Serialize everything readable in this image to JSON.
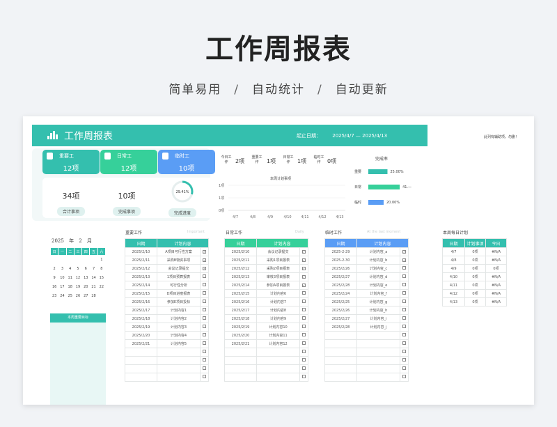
{
  "hero": {
    "title": "工作周报表",
    "features": [
      "简单易用",
      "自动统计",
      "自动更新"
    ],
    "separator": "/"
  },
  "banner": {
    "title": "工作周报表",
    "date_label": "起止日期：",
    "date_start": "2025/4/7",
    "date_end": "2025/4/13",
    "side_note": "此列有辅助项，勿删！"
  },
  "colors": {
    "teal": "#34bfae",
    "green": "#36d09a",
    "blue": "#5a9df5",
    "light": "#dff1ef"
  },
  "cards": [
    {
      "label": "重要工",
      "value": "12项",
      "color": "#34bfae"
    },
    {
      "label": "日常工",
      "value": "12项",
      "color": "#36d09a"
    },
    {
      "label": "临时工",
      "value": "10项",
      "color": "#5a9df5"
    }
  ],
  "stats": [
    {
      "value": "34项",
      "label": "合计事项"
    },
    {
      "value": "10项",
      "label": "完成事项"
    },
    {
      "value": "29.41%",
      "label": "完成进度"
    }
  ],
  "progress_fraction": 0.2941,
  "today": [
    {
      "label": "今日工作",
      "value": "2项"
    },
    {
      "label": "重要工作",
      "value": "1项"
    },
    {
      "label": "日常工作",
      "value": "1项"
    },
    {
      "label": "临时工作",
      "value": "0项"
    }
  ],
  "line_chart": {
    "title": "本周计划事项",
    "y_ticks": [
      "1项",
      "1项",
      "0项"
    ],
    "x": [
      "4/7",
      "4/8",
      "4/9",
      "4/10",
      "4/11",
      "4/12",
      "4/13"
    ]
  },
  "completion": {
    "title": "完成率",
    "rows": [
      {
        "label": "重要",
        "value": "25.00%",
        "fraction": 0.25,
        "color": "#34bfae"
      },
      {
        "label": "日常",
        "value": "41.—",
        "fraction": 0.41,
        "color": "#36d09a"
      },
      {
        "label": "临时",
        "value": "20.00%",
        "fraction": 0.2,
        "color": "#5a9df5"
      }
    ]
  },
  "calendar": {
    "year": "2025",
    "year_suffix": "年",
    "month": "2",
    "month_suffix": "月",
    "weekdays": [
      "日",
      "一",
      "二",
      "三",
      "四",
      "五",
      "六"
    ],
    "weeks": [
      [
        "",
        "",
        "",
        "",
        "",
        "",
        "1"
      ],
      [
        "2",
        "3",
        "4",
        "5",
        "6",
        "7",
        "8"
      ],
      [
        "9",
        "10",
        "11",
        "12",
        "13",
        "14",
        "15"
      ],
      [
        "16",
        "17",
        "18",
        "19",
        "20",
        "21",
        "22"
      ],
      [
        "23",
        "24",
        "25",
        "26",
        "27",
        "28",
        ""
      ]
    ],
    "goal_title": "本周重要目标"
  },
  "important": {
    "title": "重要工作",
    "ghost": "Important",
    "headers": [
      "日期",
      "计划内容"
    ],
    "rows": [
      [
        "2025/2/10",
        "A项目可行性方案",
        "✓"
      ],
      [
        "2025/2/11",
        "采购B物资事项",
        "✓"
      ],
      [
        "2025/2/12",
        "会议记录提交",
        "✓"
      ],
      [
        "2025/2/13",
        "1项目预算报表",
        ""
      ],
      [
        "2025/2/14",
        "可行性分析",
        ""
      ],
      [
        "2025/2/15",
        "D项目进度报表",
        ""
      ],
      [
        "2025/2/16",
        "参加E项目投标",
        ""
      ],
      [
        "2025/2/17",
        "计划内容1",
        ""
      ],
      [
        "2025/2/18",
        "计划内容2",
        ""
      ],
      [
        "2025/2/19",
        "计划内容3",
        ""
      ],
      [
        "2025/2/20",
        "计划内容4",
        ""
      ],
      [
        "2025/2/21",
        "计划内容5",
        ""
      ],
      [
        "",
        "",
        ""
      ],
      [
        "",
        "",
        ""
      ],
      [
        "",
        "",
        ""
      ],
      [
        "",
        "",
        ""
      ]
    ]
  },
  "daily": {
    "title": "日常工作",
    "ghost": "Daily",
    "headers": [
      "日期",
      "计划内容"
    ],
    "rows": [
      [
        "2025/2/10",
        "会议记录提交",
        "✓"
      ],
      [
        "2025/2/11",
        "采购1项目报表",
        "✓"
      ],
      [
        "2025/2/12",
        "采购2项目报表",
        "✓"
      ],
      [
        "2025/2/13",
        "审核3项目报表",
        "✓"
      ],
      [
        "2025/2/14",
        "参加A项目报表",
        "✓"
      ],
      [
        "2025/2/15",
        "计划内容6",
        ""
      ],
      [
        "2025/2/16",
        "计划内容7",
        ""
      ],
      [
        "2025/2/17",
        "计划内容8",
        ""
      ],
      [
        "2025/2/18",
        "计划内容9",
        ""
      ],
      [
        "2025/2/19",
        "计划内容10",
        ""
      ],
      [
        "2025/2/20",
        "计划内容11",
        ""
      ],
      [
        "2025/2/21",
        "计划内容12",
        ""
      ],
      [
        "",
        "",
        ""
      ],
      [
        "",
        "",
        ""
      ],
      [
        "",
        "",
        ""
      ],
      [
        "",
        "",
        ""
      ]
    ]
  },
  "temp": {
    "title": "临时工作",
    "ghost": "At the last moment",
    "headers": [
      "日期",
      "计划内容"
    ],
    "rows": [
      [
        "2025-2-29",
        "计划内容_a",
        "✓"
      ],
      [
        "2025-2-30",
        "计划内容_b",
        "✓"
      ],
      [
        "2025/2/26",
        "计划内容_c",
        ""
      ],
      [
        "2025/2/27",
        "计划内容_d",
        ""
      ],
      [
        "2025/2/28",
        "计划内容_e",
        ""
      ],
      [
        "2025/2/24",
        "计划内容_f",
        ""
      ],
      [
        "2025/2/25",
        "计划内容_g",
        ""
      ],
      [
        "2025/2/26",
        "计划内容_h",
        ""
      ],
      [
        "2025/2/27",
        "计划内容_i",
        ""
      ],
      [
        "2025/2/28",
        "计划内容_j",
        ""
      ],
      [
        "",
        "",
        ""
      ],
      [
        "",
        "",
        ""
      ],
      [
        "",
        "",
        ""
      ],
      [
        "",
        "",
        ""
      ],
      [
        "",
        "",
        ""
      ],
      [
        "",
        "",
        ""
      ]
    ]
  },
  "weekly": {
    "title": "本周每日计划",
    "headers": [
      "日期",
      "计划事项",
      "今日"
    ],
    "rows": [
      [
        "4/7",
        "0项",
        "#N/A"
      ],
      [
        "4/8",
        "0项",
        "#N/A"
      ],
      [
        "4/9",
        "0项",
        "0项"
      ],
      [
        "4/10",
        "0项",
        "#N/A"
      ],
      [
        "4/11",
        "0项",
        "#N/A"
      ],
      [
        "4/12",
        "0项",
        "#N/A"
      ],
      [
        "4/13",
        "0项",
        "#N/A"
      ]
    ]
  }
}
